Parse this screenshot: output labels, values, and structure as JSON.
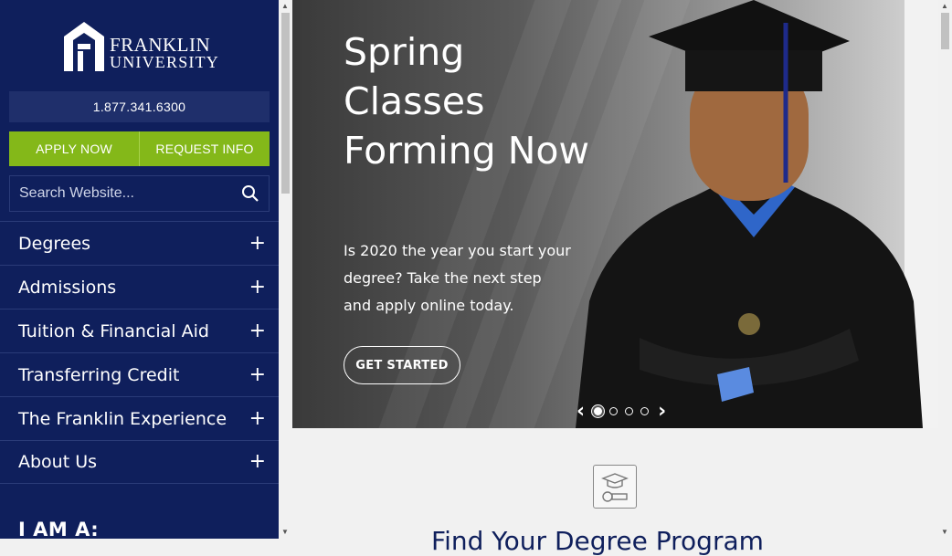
{
  "sidebar": {
    "logo": {
      "line1": "FRANKLIN",
      "line2": "UNIVERSITY"
    },
    "phone": "1.877.341.6300",
    "apply_label": "APPLY NOW",
    "request_label": "REQUEST INFO",
    "search_placeholder": "Search Website...",
    "nav": [
      {
        "label": "Degrees"
      },
      {
        "label": "Admissions"
      },
      {
        "label": "Tuition & Financial Aid"
      },
      {
        "label": "Transferring Credit"
      },
      {
        "label": "The Franklin Experience"
      },
      {
        "label": "About Us"
      }
    ],
    "expand_glyph": "+",
    "i_am_a": "I AM A:"
  },
  "hero": {
    "title": "Spring Classes Forming Now",
    "text": "Is 2020 the year you start your degree? Take the next step and apply online today.",
    "button": "GET STARTED",
    "slide_count": 4,
    "active_slide": 1
  },
  "section": {
    "heading": "Find Your Degree Program"
  },
  "colors": {
    "sidebar_bg": "#0f1f5c",
    "accent_green": "#84b819"
  }
}
